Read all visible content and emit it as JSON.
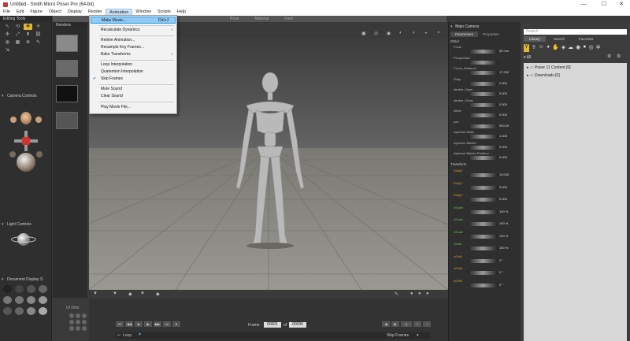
{
  "window": {
    "title": "Untitled - Smith Micro Poser Pro (64-bit)",
    "controls": [
      "—",
      "☐",
      "✕"
    ]
  },
  "menubar": {
    "items": [
      "File",
      "Edit",
      "Figure",
      "Object",
      "Display",
      "Render",
      "Animation",
      "Window",
      "Scripts",
      "Help"
    ],
    "active": "Animation"
  },
  "animation_menu": {
    "items": [
      {
        "label": "Make Movie...",
        "shortcut": "Ctrl+J",
        "highlighted": true
      },
      {
        "label": "Recalculate Dynamics",
        "submenu": true
      },
      {
        "label": "Retime Animation..."
      },
      {
        "label": "Resample Key Frames..."
      },
      {
        "label": "Bake Transforms",
        "submenu": true
      },
      {
        "label": "Loop Interpolation"
      },
      {
        "label": "Quaternion Interpolation"
      },
      {
        "label": "Skip Frames",
        "checked": true
      },
      {
        "label": "Mute Sound"
      },
      {
        "label": "Clear Sound"
      },
      {
        "label": "Play Movie File..."
      }
    ]
  },
  "tabs": [
    "Pose",
    "Material",
    "Face"
  ],
  "left_panel": {
    "editing_tools_title": "Editing Tools",
    "camera_controls_title": "Camera Controls",
    "light_controls_title": "Light Controls",
    "document_display_title": "Document Display S",
    "ui_dots_title": "UI Dots"
  },
  "renders_title": "Renders",
  "params_panel": {
    "camera_title": "Main Camera",
    "tabs": [
      "Parameters",
      "Properties"
    ],
    "other_section": "Other",
    "transform_section": "Transform",
    "rows": [
      {
        "label": "Focal",
        "value": "55 mm",
        "color": "normal"
      },
      {
        "label": "Perspective",
        "value": "",
        "color": "normal"
      },
      {
        "label": "Focus_Distance",
        "value": "17.290",
        "color": "normal"
      },
      {
        "label": "fStop",
        "value": "2.800",
        "color": "normal"
      },
      {
        "label": "shutter_Open",
        "value": "0.000",
        "color": "normal"
      },
      {
        "label": "shutter_Close",
        "value": "0.500",
        "color": "normal"
      },
      {
        "label": "hither",
        "value": "0.000",
        "color": "normal"
      },
      {
        "label": "yon",
        "value": "900.00",
        "color": "normal"
      },
      {
        "label": "Aperture Ratio",
        "value": "1.000",
        "color": "normal"
      },
      {
        "label": "Aperture Blades",
        "value": "0.000",
        "color": "normal"
      },
      {
        "label": "Aperture Blades Rotation",
        "value": "0.000",
        "color": "normal"
      },
      {
        "label": "DollyZ",
        "value": "15.000",
        "color": "orange"
      },
      {
        "label": "DollyY",
        "value": "3.600",
        "color": "orange"
      },
      {
        "label": "DollyX",
        "value": "0.000",
        "color": "orange"
      },
      {
        "label": "zScale",
        "value": "100 %",
        "color": "green"
      },
      {
        "label": "yScale",
        "value": "100 %",
        "color": "green"
      },
      {
        "label": "xScale",
        "value": "100 %",
        "color": "green"
      },
      {
        "label": "Scale",
        "value": "100 %",
        "color": "green"
      },
      {
        "label": "zOrbit",
        "value": "0 °",
        "color": "orange"
      },
      {
        "label": "xOrbit",
        "value": "0 °",
        "color": "orange"
      },
      {
        "label": "yOrbit",
        "value": "0 °",
        "color": "orange"
      }
    ]
  },
  "library": {
    "search_placeholder": "Search",
    "tabs": [
      "Library",
      "Search",
      "Favorites"
    ],
    "filter_label": "All",
    "nodes": [
      "Poser 11 Content [6]",
      "Downloads [0]"
    ]
  },
  "timeline": {
    "frame_label": "Frame:",
    "frame_value": "00001",
    "of_label": "of",
    "total_frames": "00030",
    "loop_label": "Loop",
    "skip_frames_label": "Skip Frames"
  }
}
